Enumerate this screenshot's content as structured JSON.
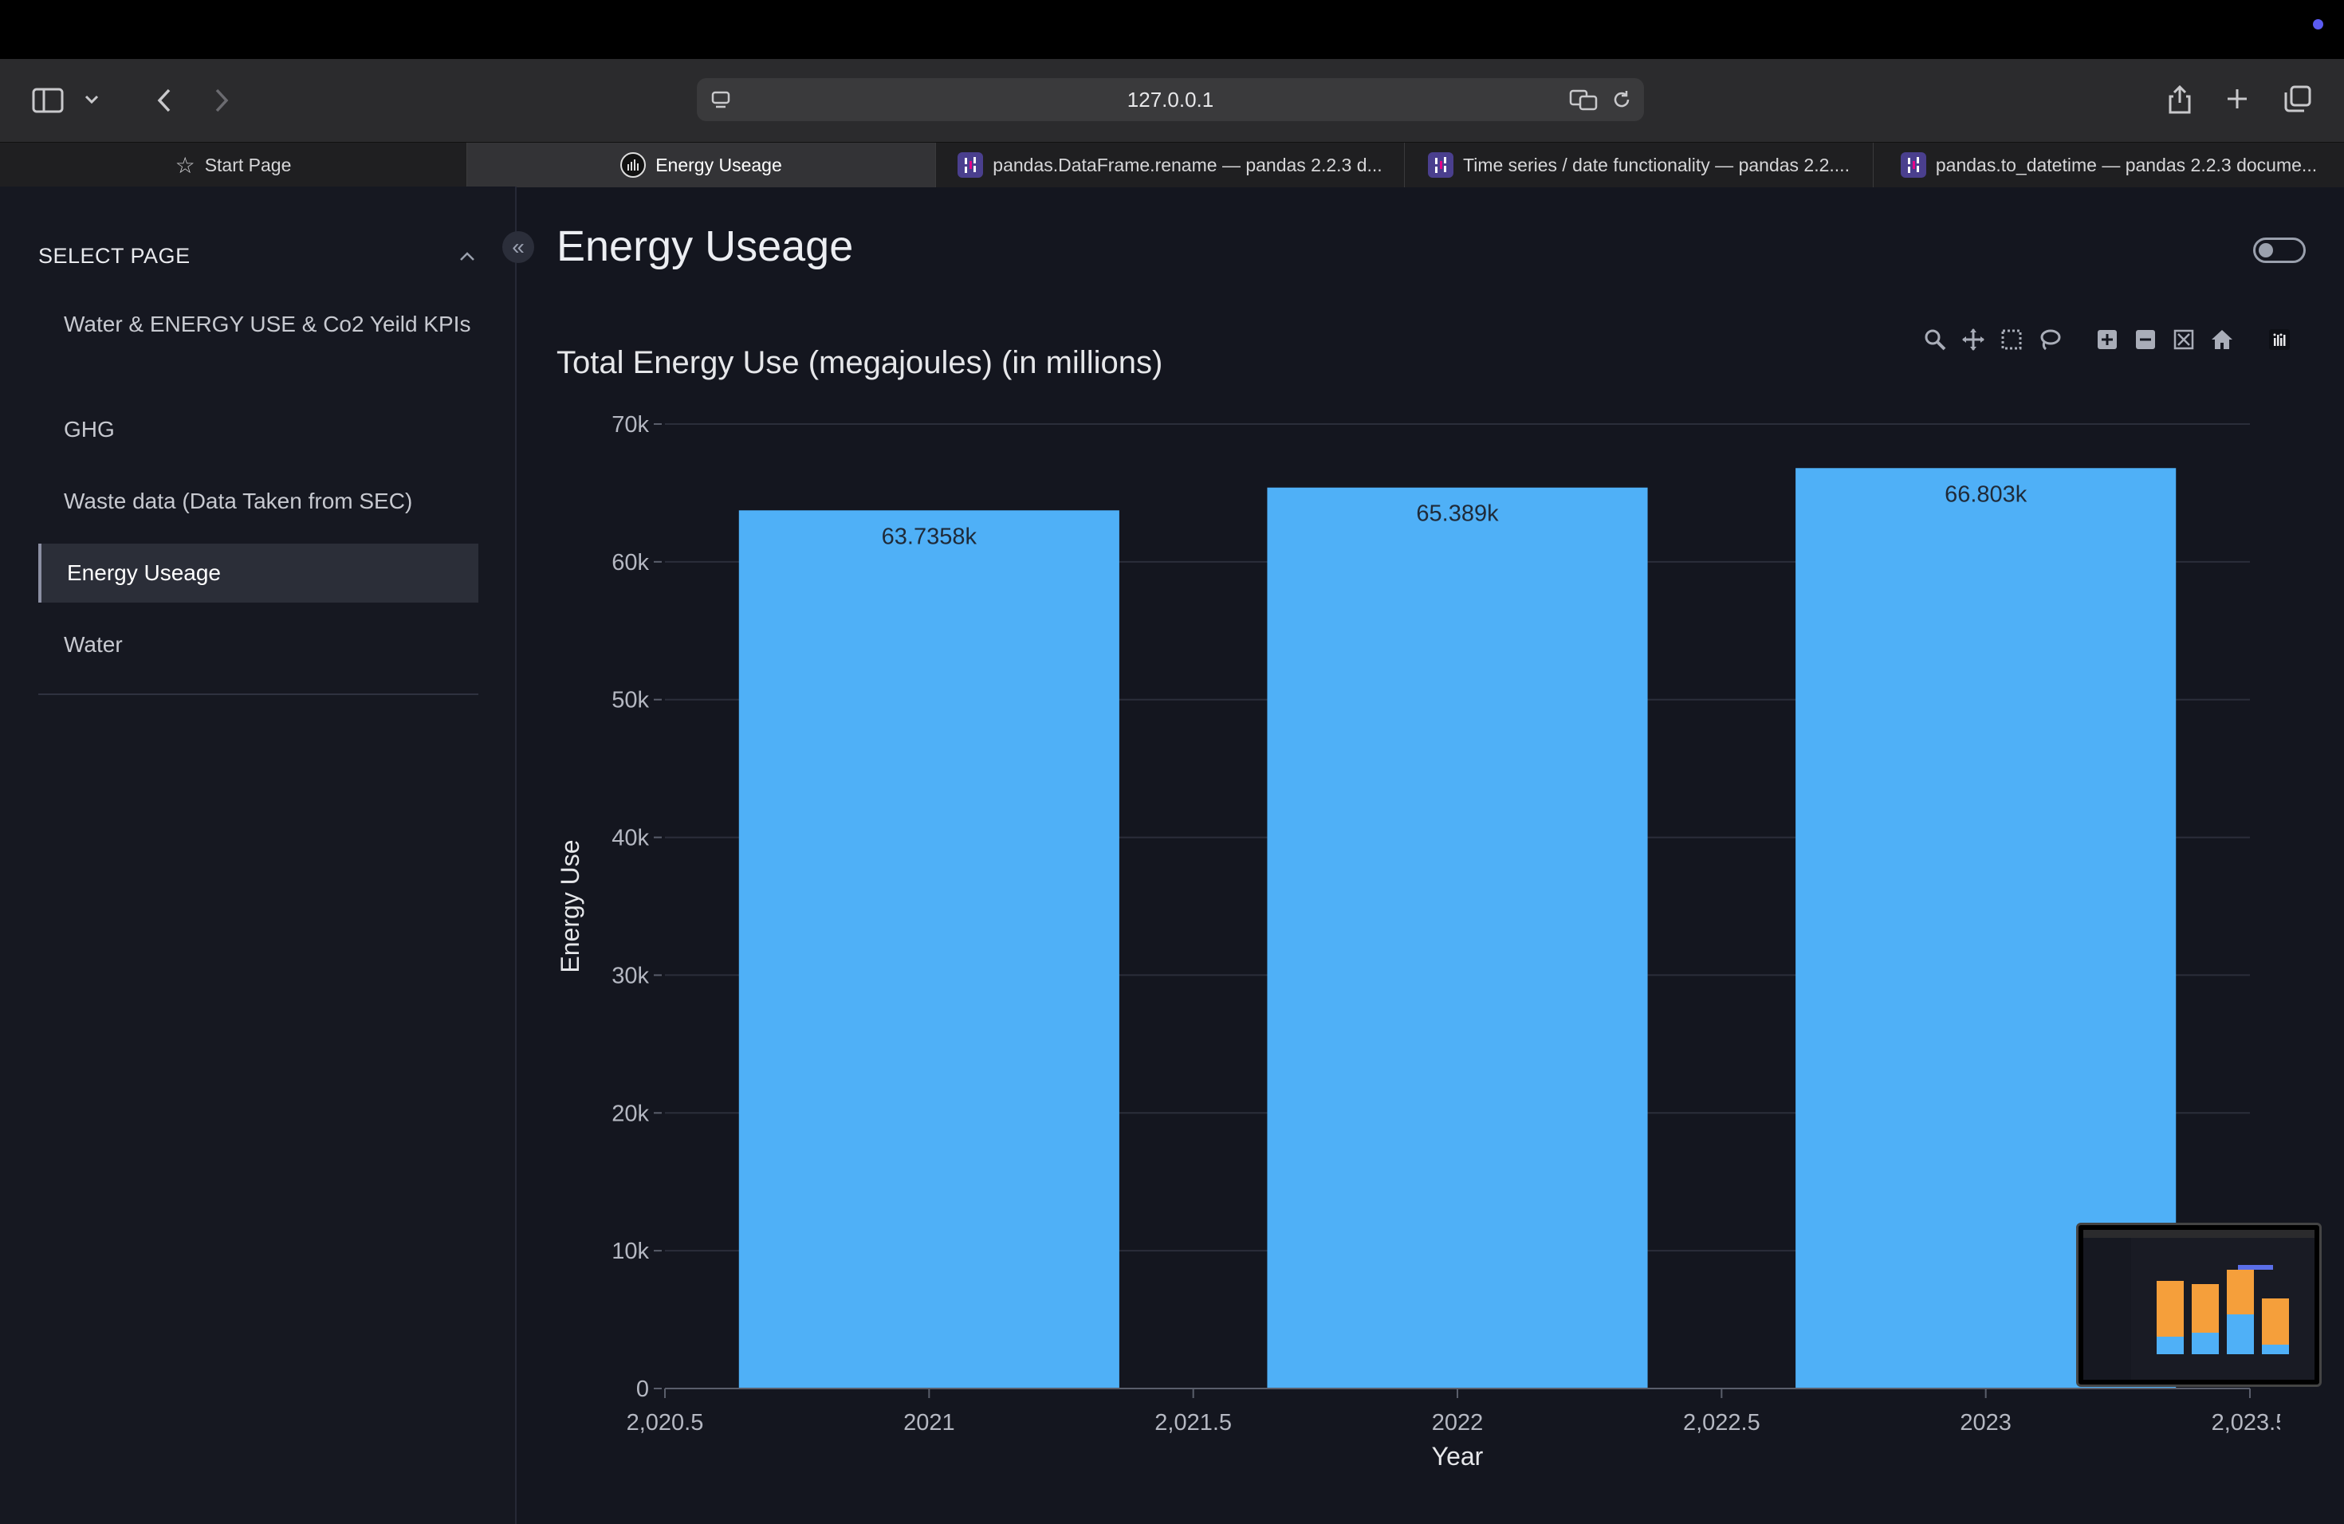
{
  "browser": {
    "address": "127.0.0.1",
    "tabs": [
      {
        "label": "Start Page",
        "active": false
      },
      {
        "label": "Energy Useage",
        "active": true
      },
      {
        "label": "pandas.DataFrame.rename — pandas 2.2.3 d...",
        "active": false
      },
      {
        "label": "Time series / date functionality — pandas 2.2....",
        "active": false
      },
      {
        "label": "pandas.to_datetime — pandas 2.2.3 docume...",
        "active": false
      }
    ]
  },
  "sidebar": {
    "heading": "SELECT PAGE",
    "items": [
      {
        "label": "Water & ENERGY USE & Co2 Yeild KPIs",
        "active": false
      },
      {
        "label": "GHG",
        "active": false
      },
      {
        "label": "Waste data (Data Taken from SEC)",
        "active": false
      },
      {
        "label": "Energy Useage",
        "active": true
      },
      {
        "label": "Water",
        "active": false
      }
    ]
  },
  "main": {
    "title": "Energy Useage"
  },
  "colors": {
    "bar": "#4fb0f7",
    "background": "#14161f",
    "grid": "#2b2e3a"
  },
  "modebar_icons": [
    "zoom-icon",
    "pan-icon",
    "box-select-icon",
    "lasso-select-icon",
    "zoom-in-icon",
    "zoom-out-icon",
    "autoscale-icon",
    "reset-axes-icon",
    "plotly-logo-icon"
  ],
  "chart_data": {
    "type": "bar",
    "title": "Total Energy Use (megajoules) (in millions)",
    "xlabel": "Year",
    "ylabel": "Energy Use",
    "x": [
      2021,
      2022,
      2023
    ],
    "values": [
      63735.8,
      65389,
      66803
    ],
    "data_labels": [
      "63.7358k",
      "65.389k",
      "66.803k"
    ],
    "xlim": [
      2020.5,
      2023.5
    ],
    "ylim": [
      0,
      70000
    ],
    "x_ticks": [
      "2,020.5",
      "2021",
      "2,021.5",
      "2022",
      "2,022.5",
      "2023",
      "2,023.5"
    ],
    "x_tick_values": [
      2020.5,
      2021,
      2021.5,
      2022,
      2022.5,
      2023,
      2023.5
    ],
    "y_ticks": [
      "0",
      "10k",
      "20k",
      "30k",
      "40k",
      "50k",
      "60k",
      "70k"
    ],
    "y_tick_values": [
      0,
      10000,
      20000,
      30000,
      40000,
      50000,
      60000,
      70000
    ],
    "grid": true
  }
}
